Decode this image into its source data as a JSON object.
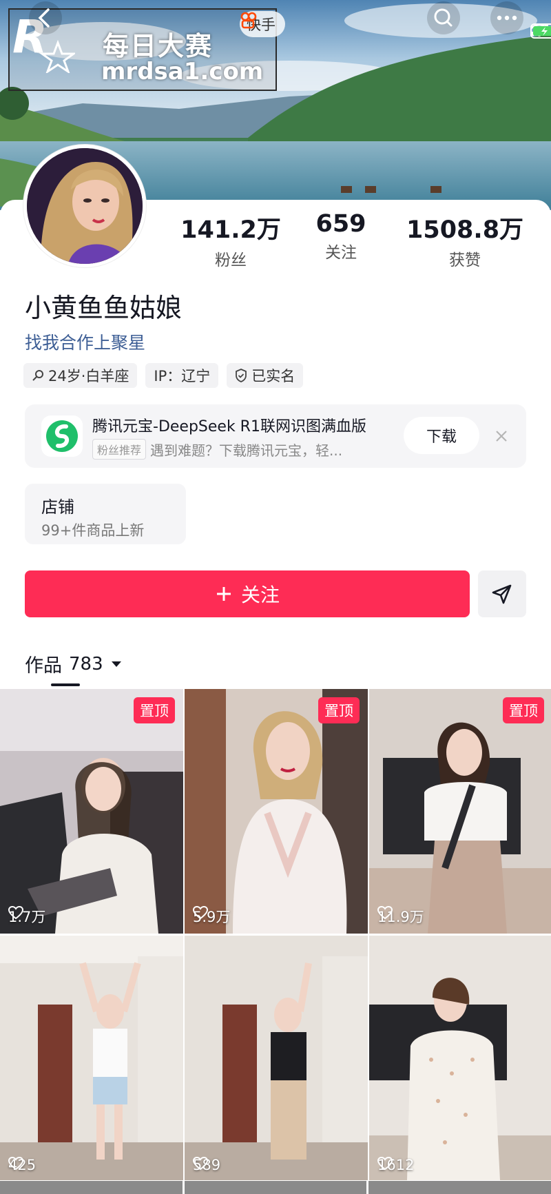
{
  "watermark": {
    "brand_cn": "每日大赛",
    "url": "mrdsa1.com",
    "logo_letter": "R"
  },
  "status_bar": {
    "app_name": "快手"
  },
  "profile": {
    "name": "小黄鱼鱼姑娘",
    "bio": "找我合作上聚星",
    "stats": [
      {
        "value": "141.2万",
        "label": "粉丝"
      },
      {
        "value": "659",
        "label": "关注"
      },
      {
        "value": "1508.8万",
        "label": "获赞"
      }
    ],
    "tags": [
      {
        "icon": "age-icon",
        "text": "24岁·白羊座"
      },
      {
        "icon": "",
        "text": "IP：辽宁"
      },
      {
        "icon": "verified-shield-icon",
        "text": "已实名"
      }
    ]
  },
  "promo": {
    "title": "腾讯元宝-DeepSeek R1联网识图满血版",
    "tag": "粉丝推荐",
    "subtitle": "遇到难题？下载腾讯元宝，轻...",
    "button": "下载"
  },
  "shop": {
    "title": "店铺",
    "subtitle": "99+件商品上新"
  },
  "actions": {
    "follow": "关注"
  },
  "works": {
    "label": "作品",
    "count": "783"
  },
  "videos": [
    {
      "likes": "1.7万",
      "pinned": "置顶"
    },
    {
      "likes": "5.9万",
      "pinned": "置顶"
    },
    {
      "likes": "11.9万",
      "pinned": "置顶"
    },
    {
      "likes": "425",
      "pinned": ""
    },
    {
      "likes": "589",
      "pinned": ""
    },
    {
      "likes": "1612",
      "pinned": ""
    }
  ],
  "colors": {
    "accent": "#fe2c55",
    "link": "#3d5e95"
  }
}
